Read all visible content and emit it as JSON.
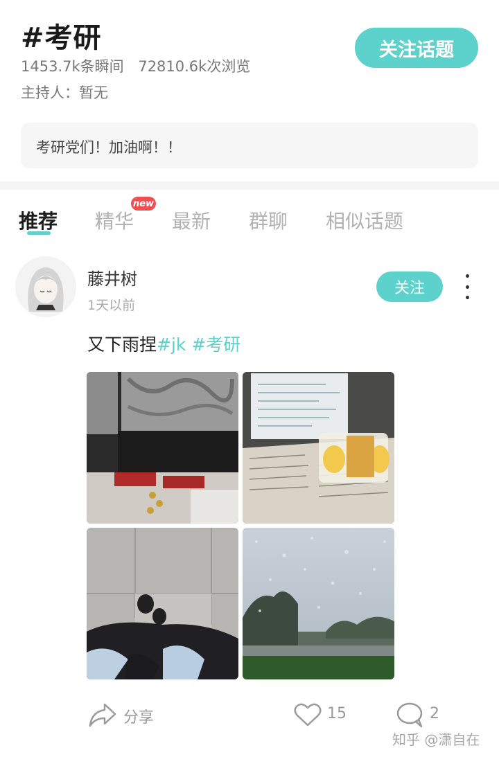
{
  "topic": {
    "title": "#考研",
    "moments": "1453.7k条瞬间",
    "views": "72810.6k次浏览",
    "host": "主持人：暂无",
    "follow_label": "关注话题",
    "description": "考研党们！加油啊！！"
  },
  "tabs": [
    {
      "label": "推荐",
      "active": true
    },
    {
      "label": "精华",
      "badge": "new"
    },
    {
      "label": "最新"
    },
    {
      "label": "群聊"
    },
    {
      "label": "相似话题"
    }
  ],
  "post": {
    "author": "藤井树",
    "time": "1天以前",
    "follow_label": "关注",
    "text_plain": "又下雨捏",
    "tags": [
      "#jk",
      "#考研"
    ],
    "footer": {
      "share_label": "分享",
      "likes": "15",
      "comments": "2"
    }
  },
  "watermark": "知乎 @潇自在",
  "colors": {
    "accent": "#5dd1cb",
    "badge": "#ee4f4f"
  },
  "icons": [
    "share-icon",
    "heart-icon",
    "comment-icon",
    "more-vertical-icon"
  ]
}
